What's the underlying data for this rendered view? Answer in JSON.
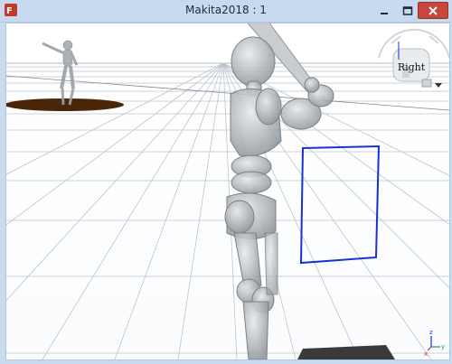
{
  "window": {
    "title": "Makita2018 : 1",
    "app_icon": "app-logo-icon",
    "controls": {
      "minimize": "minimize-icon",
      "maximize": "maximize-icon",
      "close": "close-icon"
    }
  },
  "viewport": {
    "view_cube_label": "Right",
    "axis_gizmo": {
      "x": "x",
      "y": "y",
      "z": "z"
    },
    "colors": {
      "grid": "#b9c2cc",
      "mannequin": "#9aa0a6",
      "mound": "#4a2608",
      "strike_zone": "#1b2fd6",
      "home_plate": "#3a3a3a"
    }
  }
}
